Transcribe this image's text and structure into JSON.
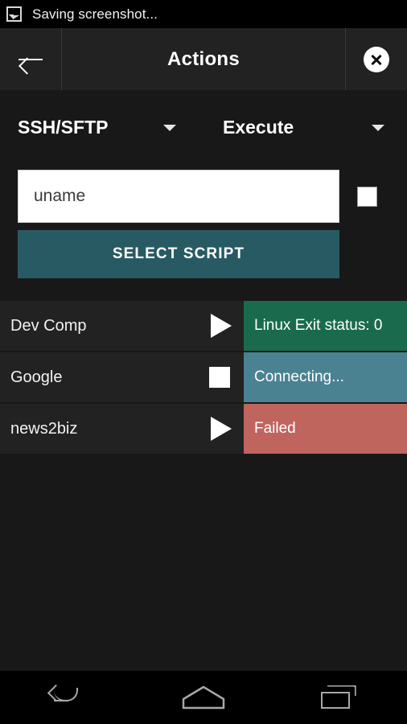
{
  "status_bar": {
    "icon": "screenshot-image-icon",
    "text": "Saving screenshot..."
  },
  "action_bar": {
    "back_icon": "arrow-left-icon",
    "title": "Actions",
    "close_icon": "close-circle-icon"
  },
  "spinners": [
    {
      "name": "protocol",
      "value": "SSH/SFTP",
      "caret": "chevron-down-icon"
    },
    {
      "name": "action",
      "value": "Execute",
      "caret": "chevron-down-icon"
    }
  ],
  "command": {
    "value": "uname",
    "placeholder": "uname",
    "checkbox_checked": true
  },
  "select_script": {
    "label": "SELECT SCRIPT",
    "color": "#285a63"
  },
  "hosts": [
    {
      "name": "Dev Comp",
      "control_icon": "play-icon",
      "status": "Linux Exit status: 0",
      "status_color": "#1a6b4d"
    },
    {
      "name": "Google",
      "control_icon": "stop-icon",
      "status": "Connecting...",
      "status_color": "#4a8292"
    },
    {
      "name": "news2biz",
      "control_icon": "play-icon",
      "status": "Failed",
      "status_color": "#c0645e"
    }
  ],
  "nav_bar": {
    "back": "nav-back-icon",
    "home": "nav-home-icon",
    "recents": "nav-recents-icon"
  }
}
